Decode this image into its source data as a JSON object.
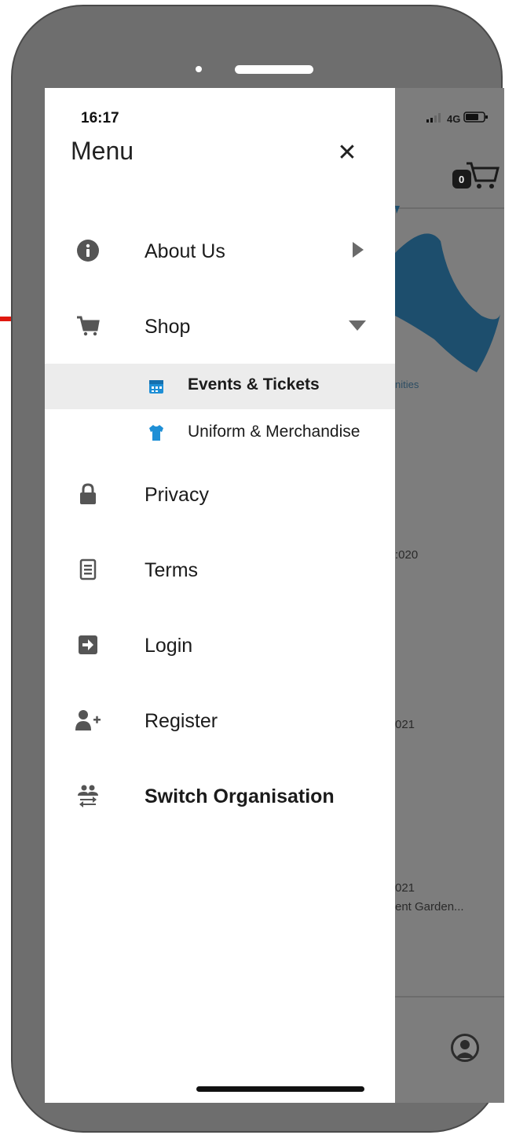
{
  "status": {
    "time": "16:17",
    "network": "4G"
  },
  "menu": {
    "title": "Menu",
    "close_symbol": "✕",
    "items": [
      {
        "label": "About Us",
        "icon": "info-icon",
        "caret": "right"
      },
      {
        "label": "Shop",
        "icon": "cart-icon",
        "caret": "down"
      },
      {
        "label": "Privacy",
        "icon": "lock-icon"
      },
      {
        "label": "Terms",
        "icon": "document-icon"
      },
      {
        "label": "Login",
        "icon": "login-icon"
      },
      {
        "label": "Register",
        "icon": "add-user-icon"
      },
      {
        "label": "Switch Organisation",
        "icon": "switch-organisation-icon"
      }
    ],
    "shop_subitems": [
      {
        "label": "Events & Tickets",
        "icon": "events-icon",
        "color": "#1e8fd6"
      },
      {
        "label": "Uniform & Merchandise",
        "icon": "shirt-icon",
        "color": "#1e8fd6"
      }
    ]
  },
  "background": {
    "cart_count": "0",
    "link_fragment": "nities",
    "text_1": ":020",
    "text_2": "021",
    "text_3a": "021",
    "text_3b": "ent Garden..."
  },
  "annotation": {
    "arrow_color": "#e0180f"
  },
  "colors": {
    "drawer_bg": "#ffffff",
    "overlay": "#7b7b7b",
    "hero_blue": "#1f5e86",
    "active_bg": "#ececec"
  }
}
